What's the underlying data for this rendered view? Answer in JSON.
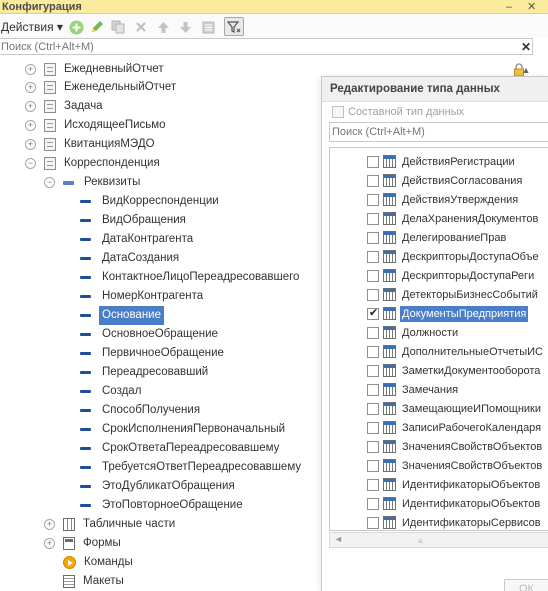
{
  "window": {
    "title": "Конфигурация",
    "minimize_label": "–",
    "close_label": "✕"
  },
  "toolbar": {
    "actions_label": "Действия ▾"
  },
  "search": {
    "placeholder": "Поиск (Ctrl+Alt+M)",
    "clear_label": "✕"
  },
  "tree": [
    {
      "label": "ЕжедневныйОтчет",
      "icon": "document-icon",
      "expander": "+"
    },
    {
      "label": "ЕженедельныйОтчет",
      "icon": "document-icon",
      "expander": "+"
    },
    {
      "label": "Задача",
      "icon": "document-icon",
      "expander": "+"
    },
    {
      "label": "ИсходящееПисьмо",
      "icon": "document-icon",
      "expander": "+"
    },
    {
      "label": "КвитанцияМЭДО",
      "icon": "document-icon",
      "expander": "+"
    },
    {
      "label": "Корреспонденция",
      "icon": "document-icon",
      "expander": "−"
    },
    {
      "label": "Реквизиты",
      "icon": "attributes-group-icon",
      "expander": "−"
    },
    {
      "label": "ВидКорреспонденции",
      "icon": "attribute-icon"
    },
    {
      "label": "ВидОбращения",
      "icon": "attribute-icon"
    },
    {
      "label": "ДатаКонтрагента",
      "icon": "attribute-icon"
    },
    {
      "label": "ДатаСоздания",
      "icon": "attribute-icon"
    },
    {
      "label": "КонтактноеЛицоПереадресовавшего",
      "icon": "attribute-icon"
    },
    {
      "label": "НомерКонтрагента",
      "icon": "attribute-icon"
    },
    {
      "label": "Основание",
      "icon": "attribute-icon",
      "selected": true
    },
    {
      "label": "ОсновноеОбращение",
      "icon": "attribute-icon"
    },
    {
      "label": "ПервичноеОбращение",
      "icon": "attribute-icon"
    },
    {
      "label": "Переадресовавший",
      "icon": "attribute-icon"
    },
    {
      "label": "Создал",
      "icon": "attribute-icon"
    },
    {
      "label": "СпособПолучения",
      "icon": "attribute-icon"
    },
    {
      "label": "СрокИсполненияПервоначальный",
      "icon": "attribute-icon"
    },
    {
      "label": "СрокОтветаПереадресовавшему",
      "icon": "attribute-icon"
    },
    {
      "label": "ТребуетсяОтветПереадресовавшему",
      "icon": "attribute-icon"
    },
    {
      "label": "ЭтоДубликатОбращения",
      "icon": "attribute-icon"
    },
    {
      "label": "ЭтоПовторноеОбращение",
      "icon": "attribute-icon"
    },
    {
      "label": "Табличные части",
      "icon": "table-icon",
      "expander": "+"
    },
    {
      "label": "Формы",
      "icon": "form-icon",
      "expander": "+"
    },
    {
      "label": "Команды",
      "icon": "command-icon"
    },
    {
      "label": "Макеты",
      "icon": "layout-icon"
    }
  ],
  "dialog": {
    "title": "Редактирование типа данных",
    "composite_label": "Составной тип данных",
    "search_placeholder": "Поиск (Ctrl+Alt+M)",
    "ok_label": "ОК",
    "types": [
      {
        "label": "ДействияРегистрации",
        "checked": false
      },
      {
        "label": "ДействияСогласования",
        "checked": false
      },
      {
        "label": "ДействияУтверждения",
        "checked": false
      },
      {
        "label": "ДелаХраненияДокументов",
        "checked": false
      },
      {
        "label": "ДелегированиеПрав",
        "checked": false
      },
      {
        "label": "ДескрипторыДоступаОбъе",
        "checked": false
      },
      {
        "label": "ДескрипторыДоступаРеги",
        "checked": false
      },
      {
        "label": "ДетекторыБизнесСобытий",
        "checked": false
      },
      {
        "label": "ДокументыПредприятия",
        "checked": true,
        "selected": true
      },
      {
        "label": "Должности",
        "checked": false
      },
      {
        "label": "ДополнительныеОтчетыИС",
        "checked": false
      },
      {
        "label": "ЗаметкиДокументооборота",
        "checked": false
      },
      {
        "label": "Замечания",
        "checked": false
      },
      {
        "label": "ЗамещающиеИПомощники",
        "checked": false
      },
      {
        "label": "ЗаписиРабочегоКалендаря",
        "checked": false
      },
      {
        "label": "ЗначенияСвойствОбъектов",
        "checked": false
      },
      {
        "label": "ЗначенияСвойствОбъектов",
        "checked": false
      },
      {
        "label": "ИдентификаторыОбъектов",
        "checked": false
      },
      {
        "label": "ИдентификаторыОбъектов",
        "checked": false
      },
      {
        "label": "ИдентификаторыСервисов",
        "checked": false
      }
    ]
  }
}
